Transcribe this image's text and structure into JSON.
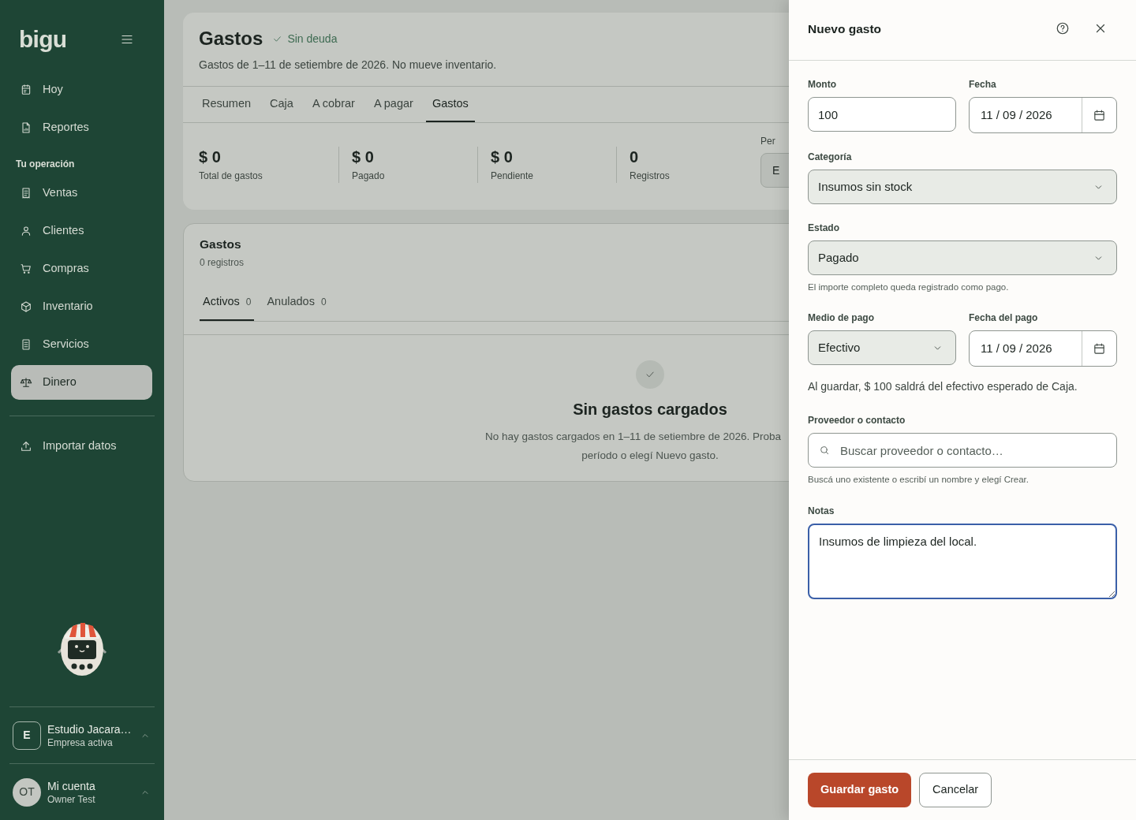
{
  "sidebar": {
    "logo": "bigu",
    "nav_top": [
      {
        "label": "Hoy",
        "selected": false
      },
      {
        "label": "Reportes",
        "selected": false
      }
    ],
    "section_title": "Tu operación",
    "nav_operation": [
      {
        "label": "Ventas",
        "selected": false
      },
      {
        "label": "Clientes",
        "selected": false
      },
      {
        "label": "Compras",
        "selected": false
      },
      {
        "label": "Inventario",
        "selected": false
      },
      {
        "label": "Servicios",
        "selected": false
      },
      {
        "label": "Dinero",
        "selected": true
      }
    ],
    "nav_bottom": [
      {
        "label": "Importar datos",
        "selected": false
      }
    ],
    "company": {
      "initial": "E",
      "name": "Estudio Jacara…",
      "subtitle": "Empresa activa"
    },
    "account": {
      "initials": "OT",
      "name": "Mi cuenta",
      "subtitle": "Owner Test"
    }
  },
  "page": {
    "title": "Gastos",
    "status": "Sin deuda",
    "subtitle": "Gastos de 1–11 de setiembre de 2026. No mueve inventario.",
    "tabs": [
      {
        "label": "Resumen",
        "selected": false
      },
      {
        "label": "Caja",
        "selected": false
      },
      {
        "label": "A cobrar",
        "selected": false
      },
      {
        "label": "A pagar",
        "selected": false
      },
      {
        "label": "Gastos",
        "selected": true
      }
    ],
    "stats": [
      {
        "value": "$ 0",
        "label": "Total de gastos"
      },
      {
        "value": "$ 0",
        "label": "Pagado"
      },
      {
        "value": "$ 0",
        "label": "Pendiente"
      },
      {
        "value": "0",
        "label": "Registros"
      }
    ],
    "period_label": "Per",
    "period_button": "E"
  },
  "list": {
    "title": "Gastos",
    "count": "0 registros",
    "tabs": [
      {
        "label": "Activos",
        "count": "0",
        "selected": true
      },
      {
        "label": "Anulados",
        "count": "0",
        "selected": false
      }
    ],
    "empty": {
      "title": "Sin gastos cargados",
      "lines": [
        "No hay gastos cargados en 1–11 de setiembre de 2026. Proba",
        "período o elegí Nuevo gasto."
      ]
    }
  },
  "drawer": {
    "title": "Nuevo gasto",
    "amount": {
      "label": "Monto",
      "value": "100"
    },
    "date": {
      "label": "Fecha",
      "value": "11 / 09 / 2026"
    },
    "category": {
      "label": "Categoría",
      "value": "Insumos sin stock"
    },
    "status": {
      "label": "Estado",
      "value": "Pagado",
      "hint": "El importe completo queda registrado como pago."
    },
    "payment_method": {
      "label": "Medio de pago",
      "value": "Efectivo"
    },
    "payment_date": {
      "label": "Fecha del pago",
      "value": "11 / 09 / 2026"
    },
    "cash_note": "Al guardar, $ 100 saldrá del efectivo esperado de Caja.",
    "contact": {
      "label": "Proveedor o contacto",
      "placeholder": "Buscar proveedor o contacto…",
      "hint": "Buscá uno existente o escribí un nombre y elegí Crear."
    },
    "notes": {
      "label": "Notas",
      "value": "Insumos de limpieza del local.",
      "focused": true
    },
    "save": "Guardar gasto",
    "cancel": "Cancelar"
  }
}
